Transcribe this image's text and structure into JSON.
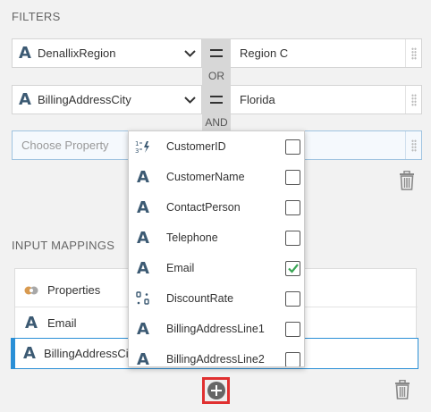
{
  "filters": {
    "title": "FILTERS",
    "rows": [
      {
        "property": "DenallixRegion",
        "value": "Region C"
      },
      {
        "property": "BillingAddressCity",
        "value": "Florida"
      }
    ],
    "logic": [
      "OR",
      "AND"
    ],
    "choose_placeholder": "Choose Property"
  },
  "dropdown": {
    "items": [
      {
        "label": "CustomerID",
        "icon": "auto-number-icon",
        "checked": false
      },
      {
        "label": "CustomerName",
        "icon": "text-type-icon",
        "checked": false
      },
      {
        "label": "ContactPerson",
        "icon": "text-type-icon",
        "checked": false
      },
      {
        "label": "Telephone",
        "icon": "text-type-icon",
        "checked": false
      },
      {
        "label": "Email",
        "icon": "text-type-icon",
        "checked": true
      },
      {
        "label": "DiscountRate",
        "icon": "decimal-type-icon",
        "checked": false
      },
      {
        "label": "BillingAddressLine1",
        "icon": "text-type-icon",
        "checked": false
      },
      {
        "label": "BillingAddressLine2",
        "icon": "text-type-icon",
        "checked": false
      }
    ]
  },
  "input_mappings": {
    "title": "INPUT MAPPINGS",
    "header": "Properties",
    "rows": [
      "Email",
      "BillingAddressCi"
    ]
  },
  "colors": {
    "accent": "#3c5a73",
    "check": "#3aa655",
    "highlight": "#e03030",
    "selected_bar": "#2a8fd6"
  }
}
